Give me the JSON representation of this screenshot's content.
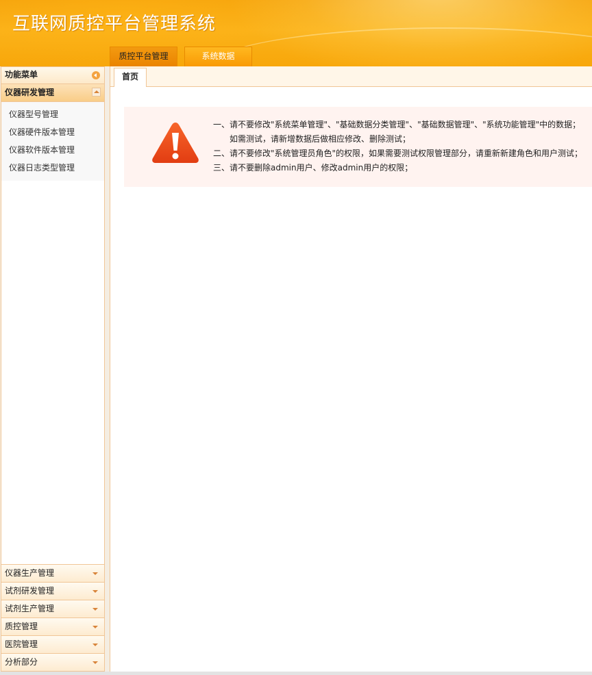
{
  "header": {
    "title": "互联网质控平台管理系统",
    "tabs": [
      {
        "label": "质控平台管理"
      },
      {
        "label": "系统数据"
      }
    ]
  },
  "sidebar": {
    "title": "功能菜单",
    "active_group": {
      "label": "仪器研发管理",
      "items": [
        {
          "label": "仪器型号管理"
        },
        {
          "label": "仪器硬件版本管理"
        },
        {
          "label": "仪器软件版本管理"
        },
        {
          "label": "仪器日志类型管理"
        }
      ]
    },
    "groups": [
      {
        "label": "仪器生产管理"
      },
      {
        "label": "试剂研发管理"
      },
      {
        "label": "试剂生产管理"
      },
      {
        "label": "质控管理"
      },
      {
        "label": "医院管理"
      },
      {
        "label": "分析部分"
      }
    ]
  },
  "main": {
    "tab_label": "首页",
    "notice_lines": [
      "一、请不要修改\"系统菜单管理\"、\"基础数据分类管理\"、\"基础数据管理\"、\"系统功能管理\"中的数据；",
      "如需测试，请新增数据后做相应修改、删除测试；",
      "二、请不要修改\"系统管理员角色\"的权限，如果需要测试权限管理部分，请重新新建角色和用户测试；",
      "三、请不要删除admin用户、修改admin用户的权限；"
    ]
  },
  "colors": {
    "header_orange": "#f8a70a",
    "border": "#f0c596",
    "notice_bg": "#fff3f0",
    "warning_red": "#e8441c"
  },
  "icons": {
    "collapse": "chevron-left-circle-icon",
    "expand_up": "arrow-up-icon",
    "expand_down": "arrow-down-icon",
    "warning": "warning-triangle-icon"
  }
}
